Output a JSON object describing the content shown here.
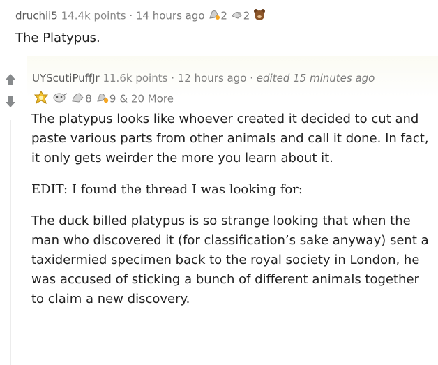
{
  "parent": {
    "author": "druchii5",
    "points": "14.4k points",
    "sep": "·",
    "time": "14 hours ago",
    "awards": [
      {
        "icon": "rocket-like-award-icon",
        "count": "2"
      },
      {
        "icon": "hand-heart-award-icon",
        "count": "2"
      },
      {
        "icon": "bear-award-icon",
        "count": ""
      }
    ],
    "body": "The Platypus."
  },
  "child": {
    "author": "UYScutiPuffJr",
    "points": "11.6k points",
    "sep1": "·",
    "time": "12 hours ago",
    "sep2": "·",
    "edited": "edited 15 minutes ago",
    "awards": [
      {
        "icon": "gold-award-icon",
        "count": ""
      },
      {
        "icon": "silver-award-icon",
        "count": ""
      },
      {
        "icon": "helpful-award-icon",
        "count": "8"
      },
      {
        "icon": "wholesome-award-icon",
        "count": "9"
      }
    ],
    "more_awards": "& 20 More",
    "paragraphs": [
      "The platypus looks like whoever created it decided to cut and paste various parts from other animals and call it done. In fact, it only gets weirder the more you learn about it.",
      "EDIT: I found the thread I was looking for:",
      "The duck billed platypus is so strange looking that when the man who discovered it (for classification’s sake anyway) sent a taxidermied specimen back to the royal society in London, he was accused of sticking a bunch of different animals together to claim a new discovery."
    ]
  },
  "colors": {
    "meta": "#7c7c7c",
    "text": "#222222",
    "vote": "#878a8c",
    "gold": "#e8b524"
  }
}
